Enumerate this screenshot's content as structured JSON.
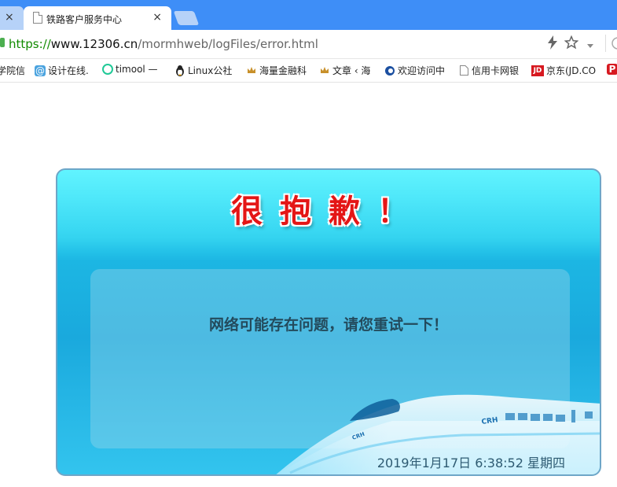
{
  "browser": {
    "prev_tab_close": "×",
    "active_tab": {
      "title": "铁路客户服务中心",
      "close": "×"
    },
    "url": {
      "scheme": "https://",
      "host": "www.12306.cn",
      "path": "/mormhweb/logFiles/error.html"
    },
    "toolbar_icons": [
      "lightning-icon",
      "star-icon",
      "chevron-down-icon"
    ]
  },
  "bookmarks": [
    {
      "label": "学院信",
      "icon": "none"
    },
    {
      "label": "设计在线.",
      "icon": "at-icon"
    },
    {
      "label": "timool —",
      "icon": "timool-icon"
    },
    {
      "label": "Linux公社",
      "icon": "penguin-icon"
    },
    {
      "label": "海量金融科",
      "icon": "crown-icon"
    },
    {
      "label": "文章 ‹ 海",
      "icon": "crown-icon"
    },
    {
      "label": "欢迎访问中",
      "icon": "circle-c-icon"
    },
    {
      "label": "信用卡网银",
      "icon": "page-icon"
    },
    {
      "label": "京东(JD.CO",
      "icon": "jd-icon"
    },
    {
      "label": "P",
      "icon": "p-icon"
    }
  ],
  "error_card": {
    "heading": "很抱歉！",
    "message": "网络可能存在问题，请您重试一下！",
    "timestamp": "2019年1月17日 6:38:52 星期四",
    "colors": {
      "heading": "#e41616",
      "panel_top": "#45f2ff",
      "panel_bottom": "#1aa9dd"
    }
  }
}
